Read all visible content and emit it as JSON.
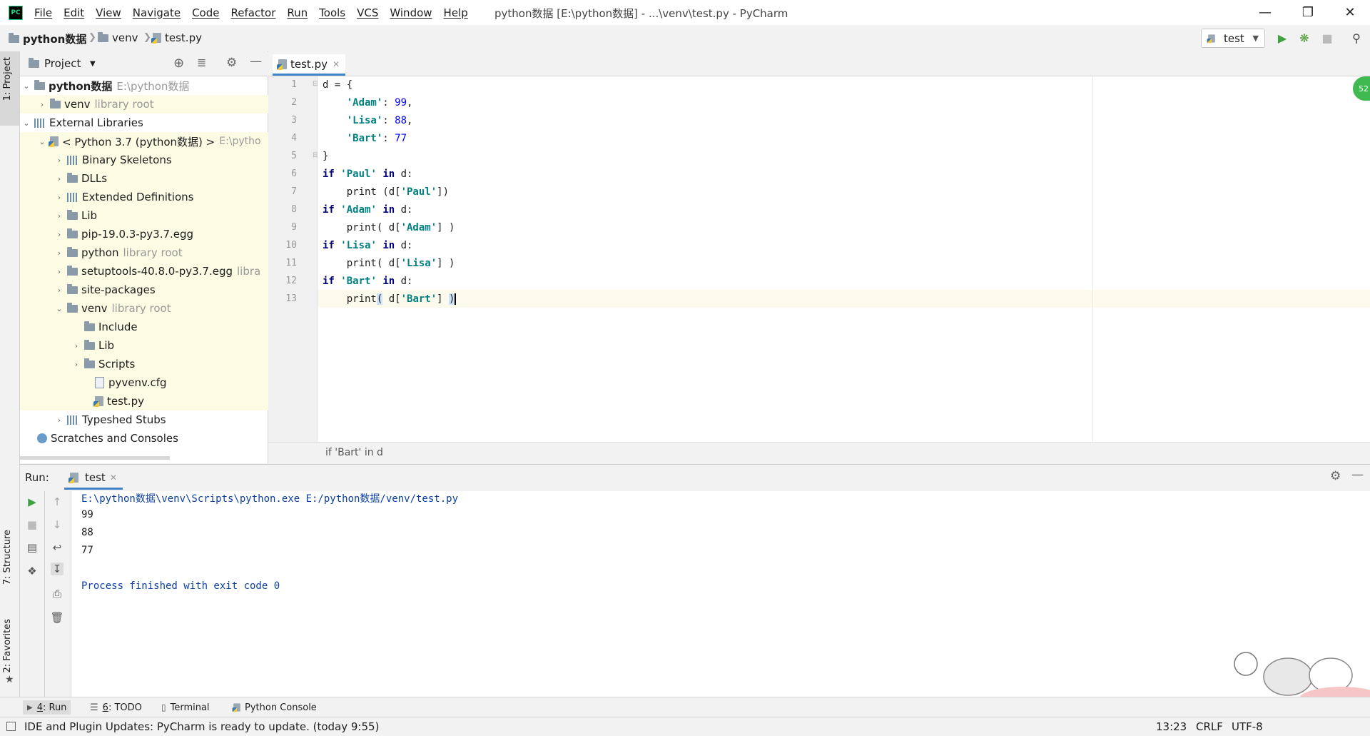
{
  "menubar": {
    "items": [
      "File",
      "Edit",
      "View",
      "Navigate",
      "Code",
      "Refactor",
      "Run",
      "Tools",
      "VCS",
      "Window",
      "Help"
    ],
    "title": "python数据 [E:\\python数据] - ...\\venv\\test.py - PyCharm",
    "logo": "PC"
  },
  "navbar": {
    "crumbs": [
      "python数据",
      "venv",
      "test.py"
    ],
    "run_config": "test"
  },
  "stripe": {
    "project": "1: Project",
    "structure": "7: Structure",
    "favorites": "2: Favorites"
  },
  "project": {
    "header": "Project",
    "rows": [
      {
        "label": "python数据",
        "extra": "E:\\python数据"
      },
      {
        "label": "venv",
        "extra": "library root"
      },
      {
        "label": "External Libraries",
        "extra": ""
      },
      {
        "label": "< Python 3.7 (python数据) >",
        "extra": "E:\\pytho"
      },
      {
        "label": "Binary Skeletons",
        "extra": ""
      },
      {
        "label": "DLLs",
        "extra": ""
      },
      {
        "label": "Extended Definitions",
        "extra": ""
      },
      {
        "label": "Lib",
        "extra": ""
      },
      {
        "label": "pip-19.0.3-py3.7.egg",
        "extra": ""
      },
      {
        "label": "python",
        "extra": "library root"
      },
      {
        "label": "setuptools-40.8.0-py3.7.egg",
        "extra": "libra"
      },
      {
        "label": "site-packages",
        "extra": ""
      },
      {
        "label": "venv",
        "extra": "library root"
      },
      {
        "label": "Include",
        "extra": ""
      },
      {
        "label": "Lib",
        "extra": ""
      },
      {
        "label": "Scripts",
        "extra": ""
      },
      {
        "label": "pyvenv.cfg",
        "extra": ""
      },
      {
        "label": "test.py",
        "extra": ""
      },
      {
        "label": "Typeshed Stubs",
        "extra": ""
      },
      {
        "label": "Scratches and Consoles",
        "extra": ""
      }
    ]
  },
  "editor": {
    "tab": "test.py",
    "line_numbers": [
      "1",
      "2",
      "3",
      "4",
      "5",
      "6",
      "7",
      "8",
      "9",
      "10",
      "11",
      "12",
      "13"
    ],
    "breadcrumb": "if 'Bart' in d",
    "badge": "52"
  },
  "run": {
    "label": "Run:",
    "tab": "test",
    "console": [
      "E:\\python数据\\venv\\Scripts\\python.exe E:/python数据/venv/test.py",
      "99",
      "88",
      "77",
      "",
      "Process finished with exit code 0"
    ]
  },
  "tooltabs": {
    "run_num": "4",
    "run": ": Run",
    "todo_num": "6",
    "todo": ": TODO",
    "terminal": "Terminal",
    "python_console": "Python Console"
  },
  "status": {
    "message": "IDE and Plugin Updates: PyCharm is ready to update. (today 9:55)",
    "position": "13:23",
    "line_sep": "CRLF",
    "encoding": "UTF-8"
  },
  "colors": {
    "accent": "#4083c9",
    "keyword": "#000080",
    "string": "#008080",
    "number": "#0000ff",
    "console_blue": "#0b3fa3"
  }
}
